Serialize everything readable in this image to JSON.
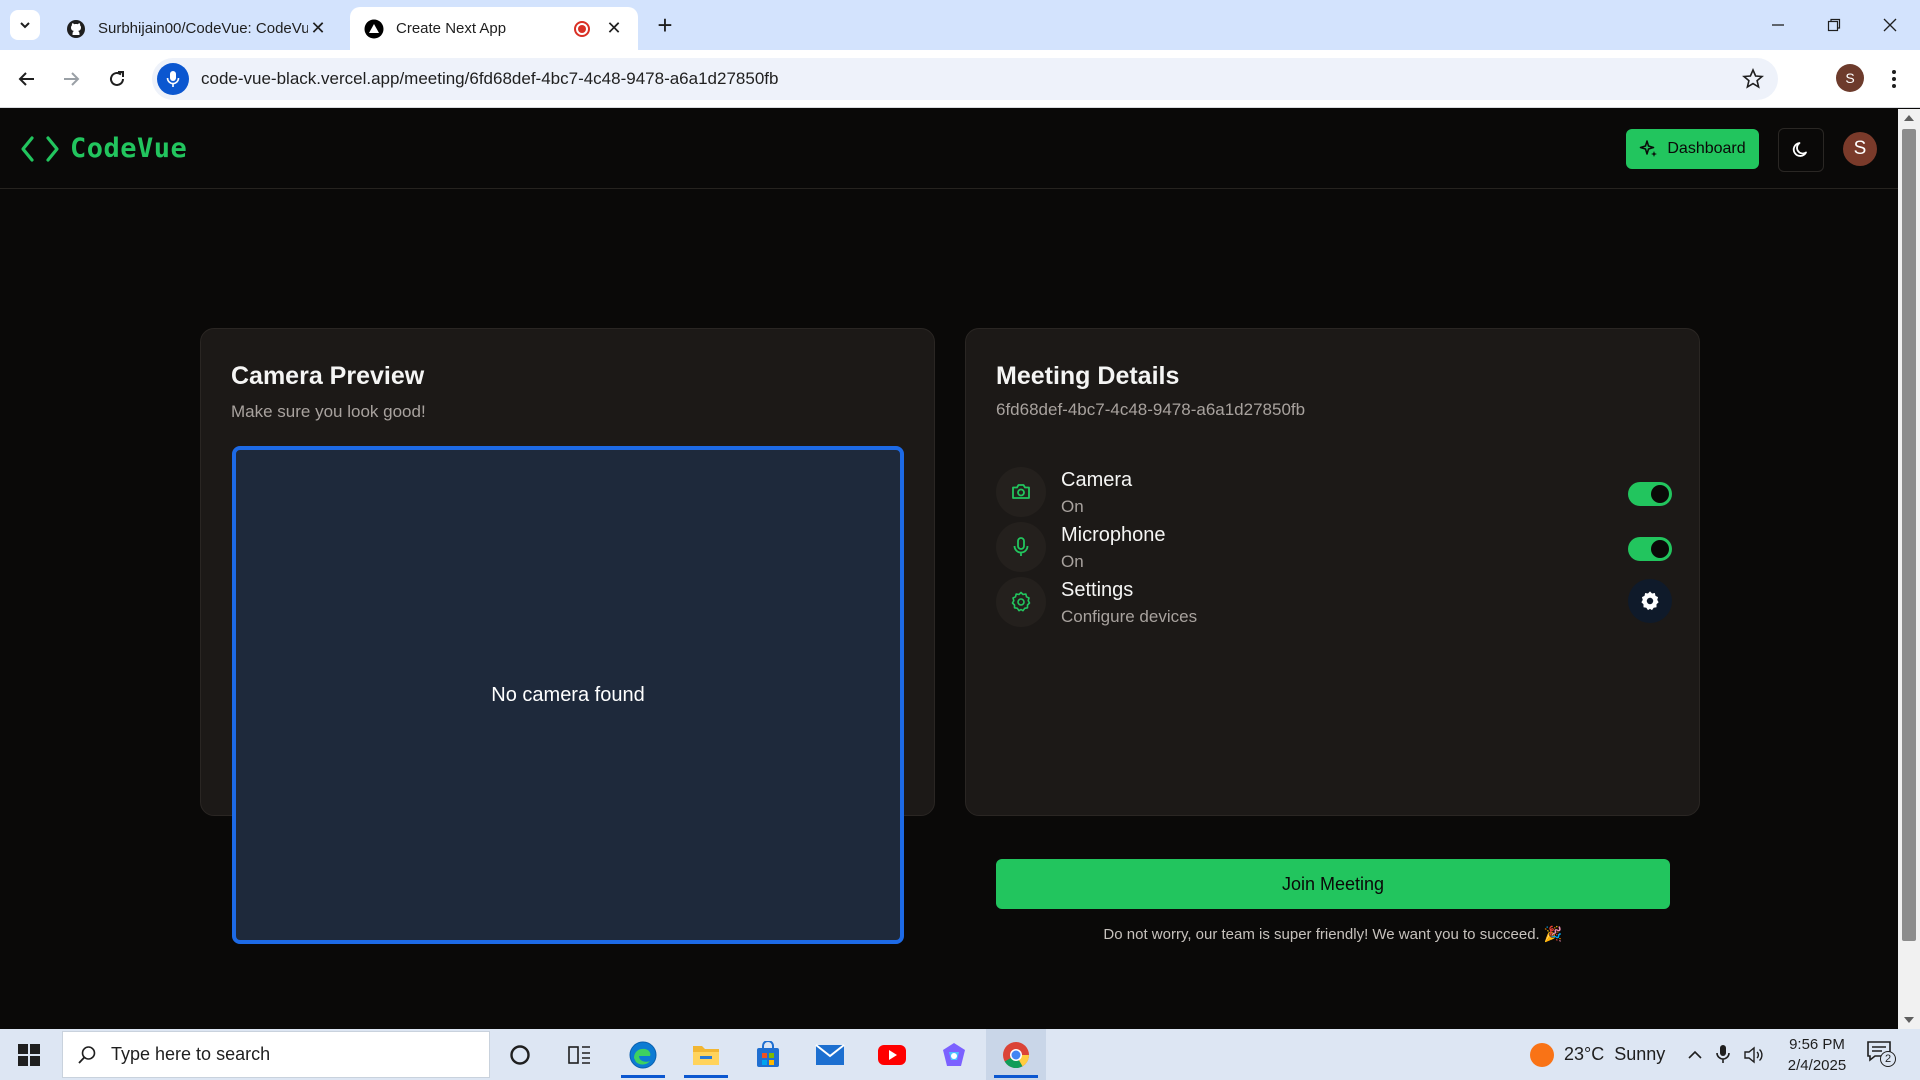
{
  "browser": {
    "tabs": [
      {
        "title": "Surbhijain00/CodeVue: CodeVu",
        "active": false
      },
      {
        "title": "Create Next App",
        "active": true
      }
    ],
    "new_tab_symbol": "+",
    "close_symbol": "✕",
    "url": "code-vue-black.vercel.app/meeting/6fd68def-4bc7-4c48-9478-a6a1d27850fb",
    "profile_initial": "S"
  },
  "app": {
    "brand": "CodeVue",
    "dashboard_label": "Dashboard",
    "user_initial": "S",
    "accent_color": "#22c55e"
  },
  "preview_card": {
    "title": "Camera Preview",
    "subtitle": "Make sure you look good!",
    "empty_message": "No camera found"
  },
  "details_card": {
    "title": "Meeting Details",
    "meeting_id": "6fd68def-4bc7-4c48-9478-a6a1d27850fb",
    "options": [
      {
        "name": "Camera",
        "value": "On",
        "icon": "camera-icon",
        "enabled": true
      },
      {
        "name": "Microphone",
        "value": "On",
        "icon": "mic-icon",
        "enabled": true
      },
      {
        "name": "Settings",
        "value": "Configure devices",
        "icon": "settings-icon"
      }
    ],
    "join_label": "Join Meeting",
    "footnote": "Do not worry, our team is super friendly! We want you to succeed. 🎉"
  },
  "taskbar": {
    "search_placeholder": "Type here to search",
    "weather": "23°C  Sunny",
    "time": "9:56 PM",
    "date": "2/4/2025",
    "notification_count": "2"
  }
}
